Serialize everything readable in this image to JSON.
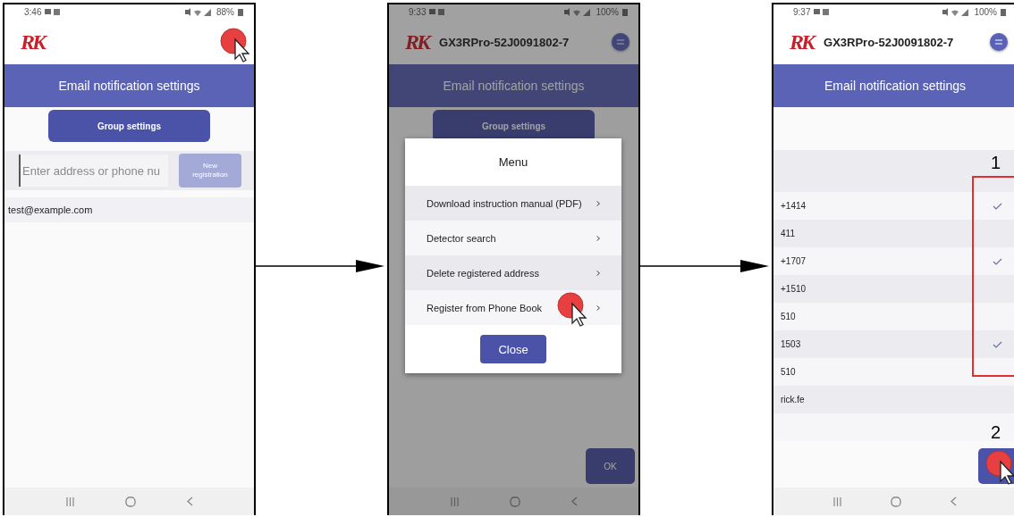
{
  "screens": [
    {
      "kind": "registration",
      "status_bar": {
        "time": "3:46",
        "battery": "88%"
      },
      "header": {
        "logo": "RK",
        "menu_tapped": true
      },
      "title": "Email notification settings",
      "group_button": "Group settings",
      "address_field": {
        "placeholder": "Enter address or phone nu"
      },
      "new_button": {
        "label": "New\nregistration",
        "disabled": true
      },
      "addresses": [
        "test@example.com"
      ]
    },
    {
      "kind": "menu",
      "dimmed": true,
      "status_bar": {
        "time": "9:33",
        "battery": "100%"
      },
      "header": {
        "logo": "RK",
        "device": "GX3RPro-52J0091802-7"
      },
      "title": "Email notification settings",
      "group_button": "Group settings",
      "dialog": {
        "title": "Menu",
        "items": [
          {
            "label": "Download instruction manual (PDF)",
            "tapped": false
          },
          {
            "label": "Detector search",
            "tapped": false
          },
          {
            "label": "Delete registered address",
            "tapped": false
          },
          {
            "label": "Register from Phone Book",
            "tapped": true
          }
        ],
        "close": "Close"
      },
      "ok_button": {
        "label": "OK"
      }
    },
    {
      "kind": "picker",
      "status_bar": {
        "time": "9:37",
        "battery": "100%"
      },
      "header": {
        "logo": "RK",
        "device": "GX3RPro-52J0091802-7"
      },
      "title": "Email notification settings",
      "step_1": "1",
      "contacts": [
        {
          "name": "+1414",
          "checked": true
        },
        {
          "name": "411",
          "checked": false
        },
        {
          "name": "+1707",
          "checked": true
        },
        {
          "name": "+1510",
          "checked": false
        },
        {
          "name": "510",
          "checked": false
        },
        {
          "name": "1503",
          "checked": true
        },
        {
          "name": "510",
          "checked": false
        },
        {
          "name": "rick.fe",
          "checked": false
        }
      ],
      "step_2": "2",
      "ok_button": {
        "tapped": true
      }
    }
  ]
}
